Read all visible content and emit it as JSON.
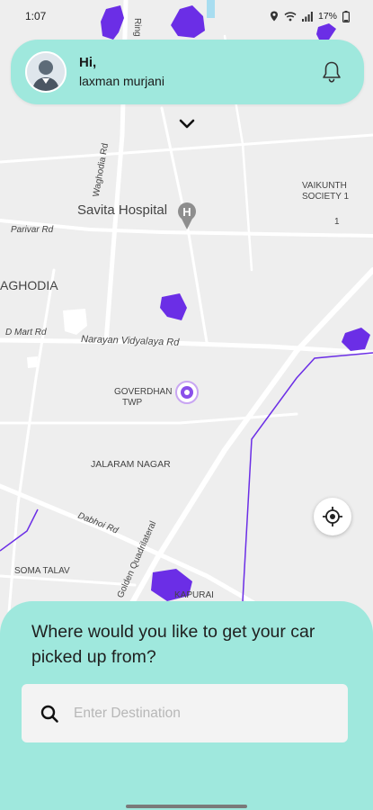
{
  "status_bar": {
    "time": "1:07",
    "battery": "17%"
  },
  "header": {
    "greeting": "Hi,",
    "username": "laxman murjani"
  },
  "map": {
    "labels": {
      "ring_rd": "Ring Rd",
      "waghodia_rd": "Waghodia Rd",
      "vaikunth_society": "VAIKUNTH",
      "vaikunth_society_2": "SOCIETY 1",
      "vaikunth_num": "1",
      "savita_hospital": "Savita Hospital",
      "hospital_marker": "H",
      "parivar_rd": "Parivar Rd",
      "waghodia": "AGHODIA",
      "dmart_rd": "D Mart Rd",
      "narayan_vidyalaya_rd": "Narayan Vidyalaya Rd",
      "goverdhan": "GOVERDHAN",
      "goverdhan_2": "TWP",
      "jalaram_nagar": "JALARAM NAGAR",
      "dabhoi_rd": "Dabhoi Rd",
      "golden_quadrilateral": "Golden Quadrilateral",
      "soma_talav": "SOMA TALAV",
      "kapurai": "KAPURAI"
    },
    "overlay_color": "#6b2ee6",
    "water_color": "#a8ddf0"
  },
  "bottom_sheet": {
    "question": "Where would you like to get your car picked up from?",
    "search_placeholder": "Enter Destination"
  },
  "colors": {
    "accent": "#9fe8dd"
  },
  "icons": [
    "avatar-icon",
    "bell-icon",
    "chevron-down-icon",
    "locate-icon",
    "search-icon",
    "location-pin-icon",
    "wifi-icon",
    "signal-icon",
    "battery-icon"
  ]
}
